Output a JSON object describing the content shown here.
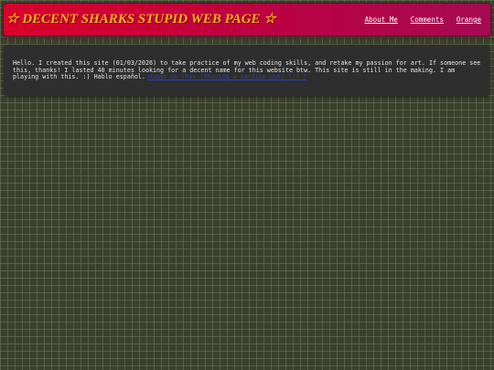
{
  "header": {
    "title": "☆ DECENT SHARKS STUPID WEB PAGE ☆",
    "nav": [
      {
        "label": "About Me"
      },
      {
        "label": "Comments"
      },
      {
        "label": "Orange"
      }
    ]
  },
  "intro": {
    "text": "Hello. I created this site (01/03/2026) to take practice of my web coding skills, and retake my passion for art. If someone see this, thanks! I lasted 40 minutes looking for a decent name for this website btw. This site is still in the making. I am playing with this. :) Hablo español.",
    "link_label": "Human do this (Shoving a sardine out) ! ! !"
  },
  "colors": {
    "header_gradient_start": "#d9002a",
    "header_gradient_end": "#a60a52",
    "title_color": "#ffb21a",
    "page_background": "#3b402c",
    "intro_background": "#2e2e2e",
    "link_color": "#2b3fb8"
  }
}
